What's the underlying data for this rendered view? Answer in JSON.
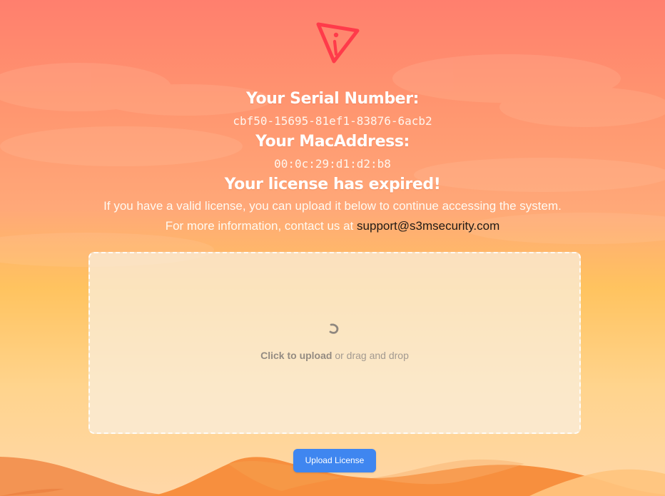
{
  "icon": {
    "name": "warning-icon",
    "color": "#ff3b4a"
  },
  "serial": {
    "label": "Your Serial Number:",
    "value": "cbf50-15695-81ef1-83876-6acb2"
  },
  "mac": {
    "label": "Your MacAddress:",
    "value": "00:0c:29:d1:d2:b8"
  },
  "license": {
    "title": "Your license has expired!",
    "message": "If you have a valid license, you can upload it below to continue accessing the system.",
    "contact_prefix": "For more information, contact us at",
    "contact_email": "support@s3msecurity.com"
  },
  "upload": {
    "click_label": "Click to upload",
    "drag_label": "or drag and drop",
    "spinner_icon": "loading-spinner-icon",
    "button_label": "Upload License"
  },
  "colors": {
    "accent": "#3f86f0",
    "icon_red": "#ff3b4a",
    "background_top": "#ff7f6e",
    "background_bottom": "#ffd7a8",
    "mountains": "#f58c47"
  }
}
